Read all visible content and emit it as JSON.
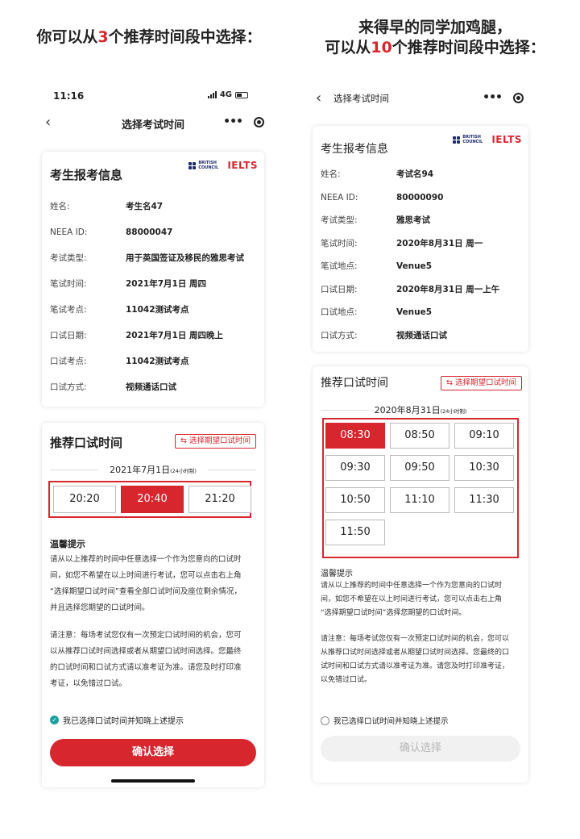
{
  "headline_left": {
    "pre": "你可以从",
    "num": "3",
    "post": "个推荐时间段中选择："
  },
  "headline_right": {
    "line1": "来得早的同学加鸡腿，",
    "pre": "可以从",
    "num": "10",
    "post": "个推荐时间段中选择："
  },
  "phone_left": {
    "status": {
      "time": "11:16",
      "network": "4G"
    },
    "nav_title": "选择考试时间",
    "info_title": "考生报考信息",
    "logo": {
      "bc": "BRITISH COUNCIL",
      "ielts": "IELTS"
    },
    "info": [
      {
        "label": "姓名:",
        "value": "考生名47"
      },
      {
        "label": "NEEA ID:",
        "value": "88000047"
      },
      {
        "label": "考试类型:",
        "value": "用于英国签证及移民的雅思考试"
      },
      {
        "label": "笔试时间:",
        "value": "2021年7月1日 周四"
      },
      {
        "label": "笔试考点:",
        "value": "11042测试考点"
      },
      {
        "label": "口试日期:",
        "value": "2021年7月1日 周四晚上"
      },
      {
        "label": "口试考点:",
        "value": "11042测试考点"
      },
      {
        "label": "口试方式:",
        "value": "视频通话口试"
      }
    ],
    "section_title": "推荐口试时间",
    "pref_button": "⇆ 选择期望口试时间",
    "date": "2021年7月1日",
    "date_note": "(24小时制)",
    "slots": [
      {
        "time": "20:20",
        "selected": false
      },
      {
        "time": "20:40",
        "selected": true
      },
      {
        "time": "21:20",
        "selected": false
      }
    ],
    "tips_title": "温馨提示",
    "tips_p1": [
      "请从以上推荐的时间中任意选择一个作为您意向的口试时",
      "间，如您不希望在以上时间进行考试，您可以点击右上角",
      "“选择期望口试时间”查看全部口试时间及座位剩余情况，",
      "并且选择您期望的口试时间。"
    ],
    "tips_p2": [
      "请注意：每场考试您仅有一次预定口试时间的机会，您可",
      "以从推荐口试时间选择或者从期望口试时间选择。您最终",
      "的口试时间和口试方式请以准考证为准。请您及时打印准",
      "考证，以免错过口试。"
    ],
    "check_label": "我已选择口试时间并知晓上述提示",
    "confirm": "确认选择"
  },
  "phone_right": {
    "nav_title": "选择考试时间",
    "info_title": "考生报考信息",
    "logo": {
      "bc": "BRITISH COUNCIL",
      "ielts": "IELTS"
    },
    "info": [
      {
        "label": "姓名:",
        "value": "考试名94"
      },
      {
        "label": "NEEA ID:",
        "value": "80000090"
      },
      {
        "label": "考试类型:",
        "value": "雅思考试"
      },
      {
        "label": "笔试时间:",
        "value": "2020年8月31日 周一"
      },
      {
        "label": "笔试地点:",
        "value": "Venue5"
      },
      {
        "label": "口试日期:",
        "value": "2020年8月31日 周一上午"
      },
      {
        "label": "口试地点:",
        "value": "Venue5"
      },
      {
        "label": "口试方式:",
        "value": "视频通话口试"
      }
    ],
    "section_title": "推荐口试时间",
    "pref_button": "⇆ 选择期望口试时间",
    "date": "2020年8月31日",
    "date_note": "(24小时制)",
    "slots": [
      {
        "time": "08:30",
        "selected": true
      },
      {
        "time": "08:50",
        "selected": false
      },
      {
        "time": "09:10",
        "selected": false
      },
      {
        "time": "09:30",
        "selected": false
      },
      {
        "time": "09:50",
        "selected": false
      },
      {
        "time": "10:30",
        "selected": false
      },
      {
        "time": "10:50",
        "selected": false
      },
      {
        "time": "11:10",
        "selected": false
      },
      {
        "time": "11:30",
        "selected": false
      },
      {
        "time": "11:50",
        "selected": false
      }
    ],
    "tips_title": "温馨提示",
    "tips_p1": [
      "请从以上推荐的时间中任意选择一个作为您意向的口试时",
      "间，如您不希望在以上时间进行考试，您可以点击右上角",
      "“选择期望口试时间”选择您期望的口试时间。"
    ],
    "tips_p2": [
      "请注意：每场考试您仅有一次预定口试时间的机会，您可以",
      "从推荐口试时间选择或者从期望口试时间选择。您最终的口",
      "试时间和口试方式请以准考证为准。请您及时打印准考证，",
      "以免错过口试。"
    ],
    "check_label": "我已选择口试时间并知晓上述提示",
    "confirm": "确认选择"
  },
  "colors": {
    "accent": "#d8262f",
    "check": "#18a0a0",
    "brand_blue": "#1c2a6e"
  }
}
